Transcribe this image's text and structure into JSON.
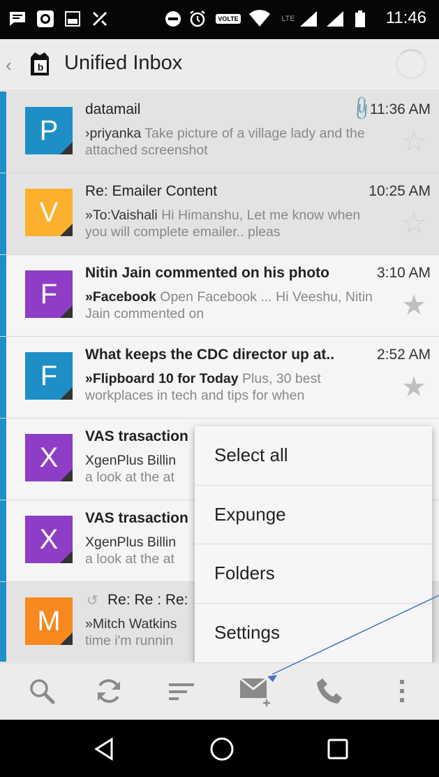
{
  "status_bar": {
    "time": "11:46",
    "volte": "VOLTE",
    "lte": "LTE"
  },
  "header": {
    "title": "Unified Inbox"
  },
  "messages": [
    {
      "avatar_letter": "P",
      "avatar_color": "#1e8fc6",
      "sender": "datamail",
      "time": "11:36 AM",
      "from": "›priyanka",
      "snippet": " Take picture of a village lady and the attached screenshot",
      "unread": false,
      "has_attachment": true
    },
    {
      "avatar_letter": "V",
      "avatar_color": "#fbb12e",
      "sender": "Re: Emailer Content",
      "time": "10:25 AM",
      "from": "»To:Vaishali",
      "snippet": " Hi Himanshu, Let me know when you will complete emailer.. pleas",
      "unread": false,
      "has_attachment": false
    },
    {
      "avatar_letter": "F",
      "avatar_color": "#8e3ec6",
      "sender": "Nitin Jain commented on his photo",
      "time": "3:10 AM",
      "from": "»Facebook",
      "snippet": " Open Facebook ... Hi Veeshu, Nitin Jain commented on",
      "unread": true,
      "has_attachment": false
    },
    {
      "avatar_letter": "F",
      "avatar_color": "#1e8fc6",
      "sender": "What keeps the CDC director up at..",
      "time": "2:52 AM",
      "from": "»Flipboard 10 for Today",
      "snippet": " Plus, 30 best workplaces in tech and tips for when",
      "unread": true,
      "has_attachment": false
    },
    {
      "avatar_letter": "X",
      "avatar_color": "#8e3ec6",
      "sender": "VAS trasaction",
      "time": "",
      "from": "XgenPlus Billin",
      "snippet": "a look at the at",
      "unread": true,
      "has_attachment": false
    },
    {
      "avatar_letter": "X",
      "avatar_color": "#8e3ec6",
      "sender": "VAS trasaction",
      "time": "",
      "from": "XgenPlus Billin",
      "snippet": "a look at the at",
      "unread": true,
      "has_attachment": false
    },
    {
      "avatar_letter": "M",
      "avatar_color": "#f7891f",
      "sender": "Re: Re : Re:",
      "time": "",
      "from": "»Mitch Watkins",
      "snippet": "time i'm runnin",
      "unread": false,
      "has_attachment": false
    }
  ],
  "menu": {
    "items": [
      "Select all",
      "Expunge",
      "Folders",
      "Settings"
    ]
  },
  "toolbar": {
    "icons": [
      "search-icon",
      "refresh-icon",
      "sort-icon",
      "compose-icon",
      "phone-icon",
      "overflow-icon"
    ]
  },
  "nav": {
    "icons": [
      "back-icon",
      "home-icon",
      "recents-icon"
    ]
  },
  "colors": {
    "accent": "#1e8fc6",
    "annotation_arrow": "#4472c4"
  }
}
